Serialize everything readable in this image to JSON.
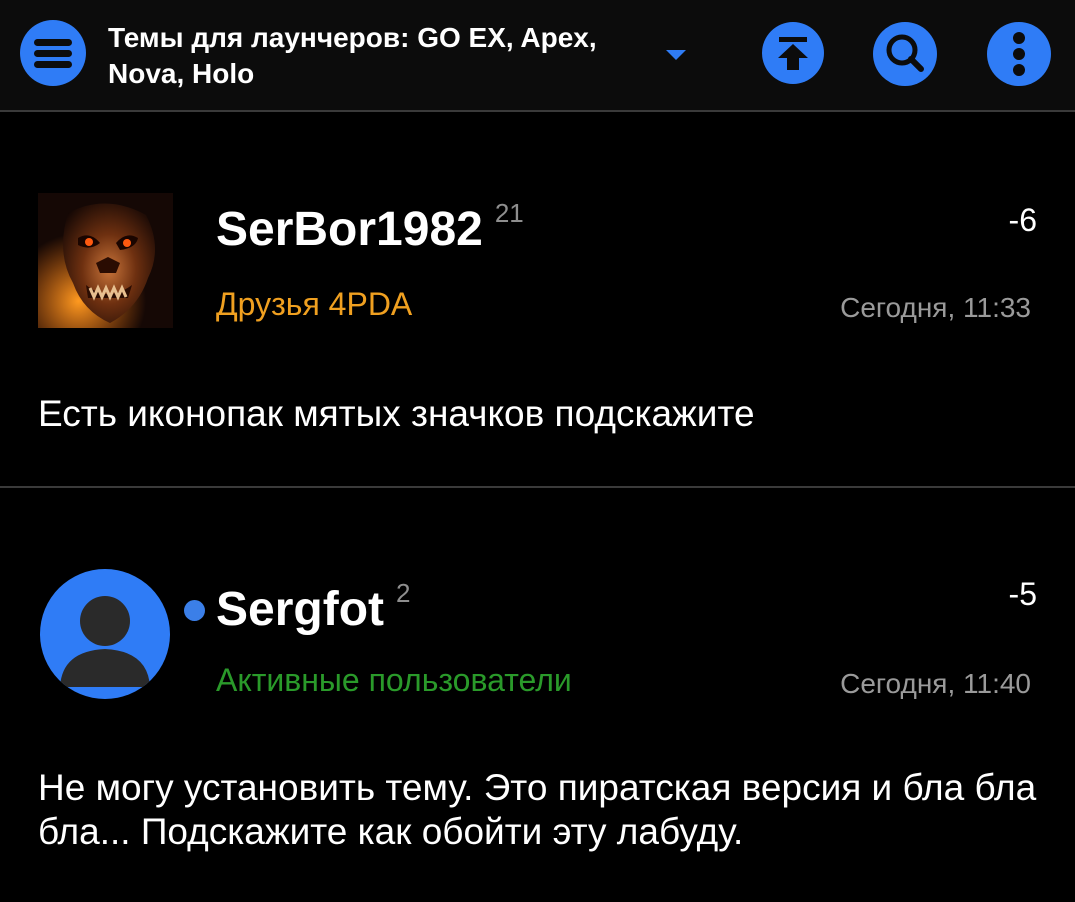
{
  "header": {
    "title": "Темы для лаунчеров: GO EX, Apex, Nova, Holo",
    "menu_icon": "hamburger-icon",
    "dropdown_icon": "caret-down-icon",
    "scroll_top_icon": "arrow-up-to-top-icon",
    "search_icon": "search-icon",
    "more_icon": "more-vertical-icon",
    "accent_color": "#2f7cf6"
  },
  "posts": [
    {
      "username": "SerBor1982",
      "reputation": "21",
      "group": "Друзья 4PDA",
      "group_color": "#f0a020",
      "score": "-6",
      "time": "Сегодня, 11:33",
      "text": "Есть иконопак мятых значков подскажите",
      "avatar": "demon-skull-avatar"
    },
    {
      "username": "Sergfot",
      "reputation": "2",
      "group": "Активные пользователи",
      "group_color": "#2a9a2a",
      "score": "-5",
      "time": "Сегодня, 11:40",
      "text": "Не могу установить тему. Это пиратская версия и бла бла бла... Подскажите как обойти эту лабуду.",
      "avatar": "default-user-avatar",
      "online": true
    }
  ]
}
